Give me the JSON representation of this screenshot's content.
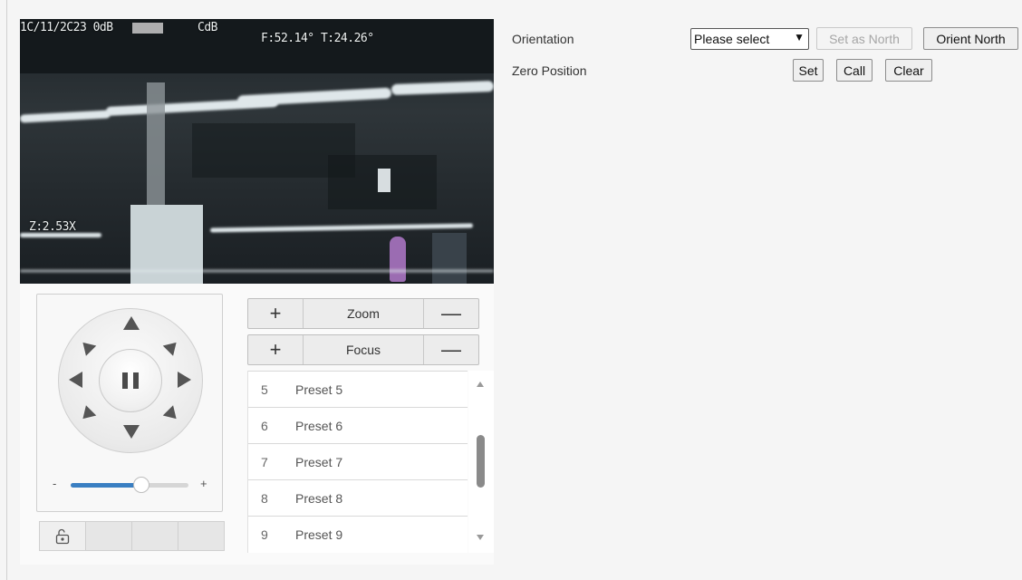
{
  "video": {
    "osd_datetime": "1C/11/2C23 0dB",
    "osd_extra": "CdB",
    "osd_ft": "F:52.14° T:24.26°",
    "osd_zoom": "Z:2.53X"
  },
  "ptz": {
    "speed_minus": "-",
    "speed_plus": "+",
    "speed_level": 0.6
  },
  "lens": {
    "zoom_label": "Zoom",
    "focus_label": "Focus",
    "plus_glyph": "+",
    "minus_glyph": "—"
  },
  "presets": [
    {
      "num": "5",
      "name": "Preset 5"
    },
    {
      "num": "6",
      "name": "Preset 6"
    },
    {
      "num": "7",
      "name": "Preset 7"
    },
    {
      "num": "8",
      "name": "Preset 8"
    },
    {
      "num": "9",
      "name": "Preset 9"
    }
  ],
  "settings": {
    "orientation_label": "Orientation",
    "orientation_select": "Please select",
    "set_as_north": "Set as North",
    "orient_north": "Orient North",
    "zero_position_label": "Zero Position",
    "set": "Set",
    "call": "Call",
    "clear": "Clear"
  },
  "colors": {
    "accent": "#3a7fc2",
    "arrow": "#555555"
  }
}
